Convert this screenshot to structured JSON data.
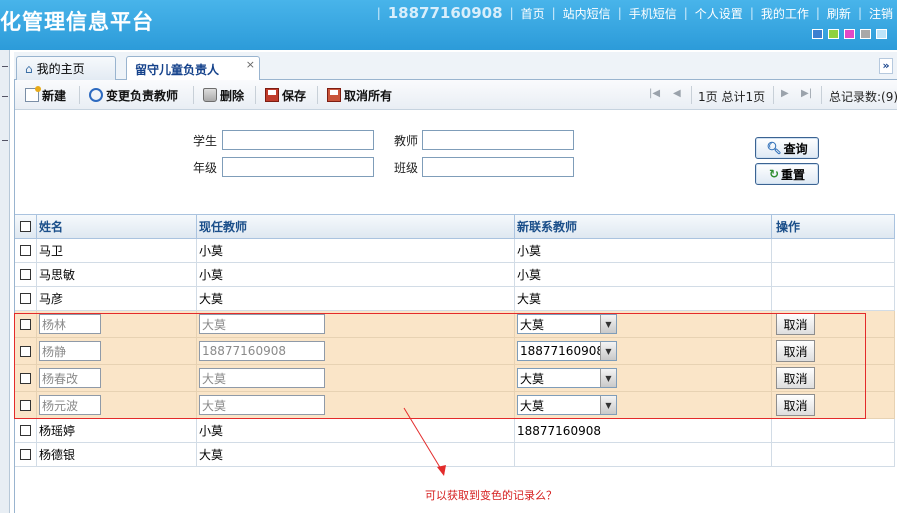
{
  "header": {
    "title": "化管理信息平台",
    "phone": "18877160908",
    "nav": [
      "首页",
      "站内短信",
      "手机短信",
      "个人设置",
      "我的工作",
      "刷新",
      "注销"
    ],
    "theme_colors": [
      "#3c7fd0",
      "#8ed240",
      "#e349c6",
      "#a9a9a9",
      "#bde4fa"
    ]
  },
  "tabs": [
    {
      "label": "我的主页",
      "icon": "home-icon"
    },
    {
      "label": "留守儿童负责人",
      "close": "×"
    }
  ],
  "toolbar": {
    "new_label": "新建",
    "change_label": "变更负责教师",
    "delete_label": "删除",
    "save_label": "保存",
    "cancel_all_label": "取消所有",
    "pager_text": "1页 总计1页",
    "total_text": "总记录数:(9)"
  },
  "search": {
    "student_label": "学生",
    "teacher_label": "教师",
    "grade_label": "年级",
    "class_label": "班级",
    "query_label": "查询",
    "reset_label": "重置"
  },
  "grid": {
    "columns": [
      "姓名",
      "现任教师",
      "新联系教师",
      "操作"
    ],
    "rows": [
      {
        "name": "马卫",
        "current": "小莫",
        "new": "小莫"
      },
      {
        "name": "马思敏",
        "current": "小莫",
        "new": "小莫"
      },
      {
        "name": "马彦",
        "current": "大莫",
        "new": "大莫"
      },
      {
        "name": "杨林",
        "current": "大莫",
        "new": "大莫",
        "action": "取消"
      },
      {
        "name": "杨静",
        "current": "18877160908",
        "new": "18877160908",
        "action": "取消"
      },
      {
        "name": "杨春改",
        "current": "大莫",
        "new": "大莫",
        "action": "取消"
      },
      {
        "name": "杨元波",
        "current": "大莫",
        "new": "大莫",
        "action": "取消"
      },
      {
        "name": "杨瑶婷",
        "current": "小莫",
        "new": "18877160908"
      },
      {
        "name": "杨德银",
        "current": "大莫",
        "new": ""
      }
    ]
  },
  "annotation": {
    "text": "可以获取到变色的记录么？",
    "color": "#e32b2b"
  }
}
